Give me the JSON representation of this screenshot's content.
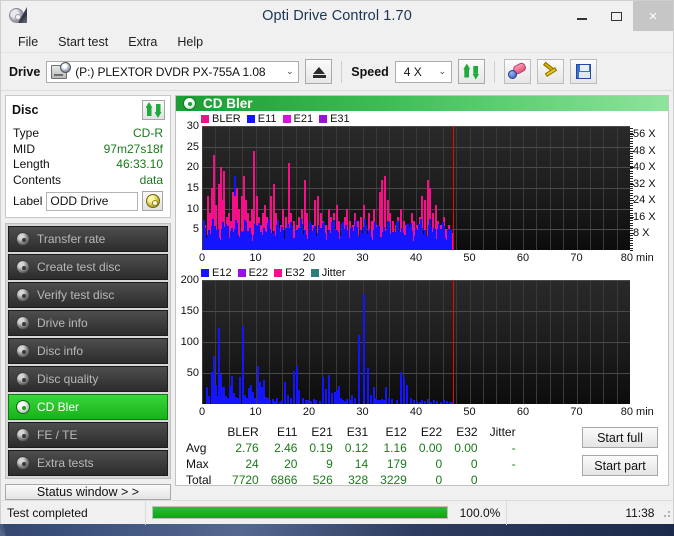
{
  "window": {
    "title": "Opti Drive Control 1.70",
    "icon": "optical-disc-icon",
    "minimize": "–",
    "maximize": "□",
    "close": "×"
  },
  "menu": {
    "items": [
      "File",
      "Start test",
      "Extra",
      "Help"
    ]
  },
  "toolbar": {
    "drive_label": "Drive",
    "drive_value": "(P:)  PLEXTOR DVDR   PX-755A 1.08",
    "eject_icon": "eject-icon",
    "speed_label": "Speed",
    "speed_value": "4 X",
    "refresh_icon": "refresh-icon",
    "erase_icon": "erase-icon",
    "tools_icon": "tools-icon",
    "save_icon": "save-icon",
    "dropdown_arrow": "⌄"
  },
  "disc": {
    "header": "Disc",
    "refresh_icon": "refresh-icon",
    "rows": [
      {
        "key": "Type",
        "value": "CD-R"
      },
      {
        "key": "MID",
        "value": "97m27s18f"
      },
      {
        "key": "Length",
        "value": "46:33.10"
      },
      {
        "key": "Contents",
        "value": "data"
      }
    ],
    "label_key": "Label",
    "label_value": "ODD Drive",
    "label_placeholder": "Label",
    "cd_icon": "cd-icon"
  },
  "nav": {
    "items": [
      {
        "label": "Transfer rate",
        "active": false
      },
      {
        "label": "Create test disc",
        "active": false
      },
      {
        "label": "Verify test disc",
        "active": false
      },
      {
        "label": "Drive info",
        "active": false
      },
      {
        "label": "Disc info",
        "active": false
      },
      {
        "label": "Disc quality",
        "active": false
      },
      {
        "label": "CD Bler",
        "active": true
      },
      {
        "label": "FE / TE",
        "active": false
      },
      {
        "label": "Extra tests",
        "active": false
      }
    ],
    "status_window_button": "Status window > >"
  },
  "panel": {
    "title": "CD Bler",
    "icon": "disc-icon"
  },
  "stats": {
    "columns": [
      "BLER",
      "E11",
      "E21",
      "E31",
      "E12",
      "E22",
      "E32",
      "Jitter"
    ],
    "rows": [
      {
        "label": "Avg",
        "values": [
          "2.76",
          "2.46",
          "0.19",
          "0.12",
          "1.16",
          "0.00",
          "0.00",
          "-"
        ]
      },
      {
        "label": "Max",
        "values": [
          "24",
          "20",
          "9",
          "14",
          "179",
          "0",
          "0",
          "-"
        ]
      },
      {
        "label": "Total",
        "values": [
          "7720",
          "6866",
          "526",
          "328",
          "3229",
          "0",
          "0",
          ""
        ]
      }
    ]
  },
  "actions": {
    "start_full": "Start full",
    "start_part": "Start part"
  },
  "statusbar": {
    "message": "Test completed",
    "percent": "100.0%",
    "progress_value": 100,
    "time": "11:38"
  },
  "chart_data": [
    {
      "type": "bar",
      "name": "bler-chart",
      "title": "CD Bler",
      "xlabel": "min",
      "ylabel": "",
      "xlim": [
        0,
        80
      ],
      "ylim": [
        0,
        30
      ],
      "y2lim": [
        0,
        60
      ],
      "xticks": [
        0,
        10,
        20,
        30,
        40,
        50,
        60,
        70,
        80
      ],
      "xtick_labels": [
        "0",
        "10",
        "20",
        "30",
        "40",
        "50",
        "60",
        "70",
        "80 min"
      ],
      "yticks": [
        5,
        10,
        15,
        20,
        25,
        30
      ],
      "y2ticks": [
        8,
        16,
        24,
        32,
        40,
        48,
        56
      ],
      "y2tick_labels": [
        "8 X",
        "16 X",
        "24 X",
        "32 X",
        "40 X",
        "48 X",
        "56 X"
      ],
      "grid": true,
      "legend": [
        {
          "name": "BLER",
          "color": "#f5108a"
        },
        {
          "name": "E11",
          "color": "#1414ff"
        },
        {
          "name": "E21",
          "color": "#dd11dd"
        },
        {
          "name": "E31",
          "color": "#9911dd"
        }
      ],
      "marker_line": {
        "x": 46.9,
        "color": "#ff0000"
      },
      "data_end_x": 46.6,
      "series": [
        {
          "name": "BLER",
          "color": "#f5108a",
          "x": [
            0.4,
            0.9,
            1.3,
            1.7,
            2.1,
            2.5,
            2.9,
            3.3,
            3.6,
            4.0,
            4.4,
            4.8,
            5.2,
            5.6,
            6.0,
            6.4,
            6.8,
            7.2,
            7.6,
            8.0,
            8.4,
            8.8,
            9.2,
            9.6,
            10.0,
            10.4,
            10.8,
            11.2,
            11.6,
            12.0,
            12.4,
            12.8,
            13.2,
            13.6,
            14.0,
            14.5,
            15.0,
            15.5,
            16.0,
            16.5,
            17.0,
            17.5,
            18.0,
            18.5,
            19.0,
            19.5,
            20.0,
            20.5,
            21.0,
            21.5,
            22.0,
            22.5,
            23.0,
            23.5,
            24.0,
            24.5,
            25.0,
            25.5,
            26.0,
            26.5,
            27.0,
            27.5,
            28.0,
            28.5,
            29.0,
            29.5,
            30.0,
            30.5,
            31.0,
            31.5,
            32.0,
            32.5,
            33.0,
            33.5,
            34.0,
            34.5,
            35.0,
            35.5,
            36.0,
            36.5,
            37.0,
            37.5,
            38.0,
            38.5,
            39.0,
            39.5,
            40.0,
            40.5,
            41.0,
            41.5,
            42.0,
            42.5,
            43.0,
            43.5,
            44.0,
            44.5,
            45.0,
            45.5,
            46.0,
            46.5
          ],
          "values": [
            6,
            13,
            9,
            15,
            23,
            11,
            16,
            20,
            12,
            19,
            8,
            9,
            7,
            14,
            13,
            15,
            10,
            13,
            18,
            12,
            9,
            7,
            10,
            24,
            13,
            8,
            6,
            9,
            11,
            8,
            7,
            13,
            16,
            9,
            7,
            6,
            10,
            8,
            21,
            9,
            7,
            6,
            8,
            10,
            17,
            9,
            7,
            6,
            12,
            13,
            9,
            7,
            6,
            10,
            8,
            9,
            11,
            7,
            6,
            8,
            10,
            7,
            6,
            9,
            7,
            8,
            11,
            6,
            9,
            7,
            10,
            6,
            14,
            17,
            18,
            12,
            9,
            7,
            6,
            8,
            10,
            7,
            6,
            5,
            9,
            7,
            6,
            8,
            13,
            12,
            17,
            15,
            9,
            11,
            7,
            6,
            8,
            5,
            6,
            4
          ]
        },
        {
          "name": "E11",
          "color": "#1414ff",
          "x": [
            0.4,
            0.9,
            1.3,
            1.7,
            2.1,
            2.5,
            2.9,
            3.3,
            3.6,
            4.0,
            4.4,
            4.8,
            5.2,
            5.6,
            6.0,
            6.4,
            6.8,
            7.2,
            7.6,
            8.0,
            8.4,
            8.8,
            9.2,
            9.6,
            10.0,
            10.4,
            10.8,
            11.2,
            11.6,
            12.0,
            12.4,
            12.8,
            13.2,
            13.6,
            14.0,
            14.5,
            15.0,
            15.5,
            16.0,
            16.5,
            17.0,
            17.5,
            18.0,
            18.5,
            19.0,
            19.5,
            20.0,
            20.5,
            21.0,
            21.5,
            22.0,
            22.5,
            23.0,
            23.5,
            24.0,
            24.5,
            25.0,
            25.5,
            26.0,
            26.5,
            27.0,
            27.5,
            28.0,
            28.5,
            29.0,
            29.5,
            30.0,
            30.5,
            31.0,
            31.5,
            32.0,
            32.5,
            33.0,
            33.5,
            34.0,
            34.5,
            35.0,
            35.5,
            36.0,
            36.5,
            37.0,
            37.5,
            38.0,
            38.5,
            39.0,
            39.5,
            40.0,
            40.5,
            41.0,
            41.5,
            42.0,
            42.5,
            43.0,
            43.5,
            44.0,
            44.5,
            45.0,
            45.5,
            46.0,
            46.5
          ],
          "values": [
            5,
            11,
            7,
            10,
            13,
            9,
            12,
            17,
            10,
            16,
            6,
            7,
            5,
            11,
            18,
            12,
            8,
            10,
            14,
            9,
            7,
            5,
            8,
            20,
            10,
            6,
            5,
            7,
            9,
            6,
            5,
            10,
            13,
            7,
            5,
            4,
            8,
            6,
            16,
            7,
            5,
            4,
            6,
            8,
            13,
            7,
            5,
            4,
            9,
            10,
            7,
            5,
            4,
            8,
            6,
            7,
            9,
            5,
            4,
            6,
            8,
            5,
            4,
            7,
            5,
            6,
            9,
            4,
            7,
            5,
            8,
            4,
            11,
            13,
            15,
            9,
            7,
            5,
            4,
            6,
            8,
            5,
            4,
            4,
            7,
            5,
            4,
            6,
            10,
            9,
            13,
            12,
            7,
            9,
            5,
            4,
            6,
            4,
            5,
            3
          ]
        }
      ]
    },
    {
      "type": "bar",
      "name": "e12-chart",
      "xlabel": "min",
      "ylabel": "",
      "xlim": [
        0,
        80
      ],
      "ylim": [
        0,
        200
      ],
      "xticks": [
        0,
        10,
        20,
        30,
        40,
        50,
        60,
        70,
        80
      ],
      "xtick_labels": [
        "0",
        "10",
        "20",
        "30",
        "40",
        "50",
        "60",
        "70",
        "80 min"
      ],
      "yticks": [
        50,
        100,
        150,
        200
      ],
      "grid": true,
      "legend": [
        {
          "name": "E12",
          "color": "#1414ff"
        },
        {
          "name": "E22",
          "color": "#9911dd"
        },
        {
          "name": "E32",
          "color": "#f5108a"
        },
        {
          "name": "Jitter",
          "color": "#2b7d7d"
        }
      ],
      "marker_line": {
        "x": 46.9,
        "color": "#ff0000"
      },
      "data_end_x": 46.6,
      "series": [
        {
          "name": "E12",
          "color": "#1414ff",
          "x": [
            0.7,
            1.2,
            1.6,
            2.0,
            2.4,
            2.7,
            3.0,
            3.4,
            3.7,
            4.0,
            4.3,
            4.6,
            5.0,
            5.4,
            5.8,
            6.2,
            6.6,
            7.0,
            7.4,
            7.8,
            8.2,
            8.6,
            9.0,
            9.4,
            9.8,
            10.2,
            10.6,
            11.0,
            11.4,
            11.8,
            12.2,
            12.6,
            13.0,
            13.4,
            13.8,
            14.3,
            14.8,
            15.3,
            15.9,
            16.4,
            17.0,
            17.5,
            18.0,
            18.6,
            19.2,
            19.7,
            20.2,
            20.7,
            21.2,
            21.8,
            22.4,
            23.0,
            23.6,
            24.2,
            24.6,
            25.0,
            25.4,
            25.8,
            26.2,
            26.6,
            27.0,
            27.4,
            27.9,
            28.5,
            29.2,
            30.0,
            30.8,
            31.4,
            31.9,
            32.3,
            32.7,
            33.0,
            33.2,
            33.5,
            33.8,
            34.2,
            34.7,
            35.4,
            36.2,
            37.0,
            37.6,
            38.2,
            38.8,
            39.4,
            40.0,
            40.5,
            41.0,
            41.5,
            42.0,
            42.6,
            43.2,
            43.8,
            44.4,
            45.0,
            45.6,
            46.2,
            46.5
          ],
          "values": [
            27,
            13,
            51,
            77,
            30,
            13,
            122,
            49,
            28,
            27,
            13,
            10,
            29,
            45,
            18,
            12,
            9,
            44,
            126,
            14,
            10,
            26,
            31,
            20,
            10,
            61,
            35,
            27,
            38,
            12,
            9,
            6,
            8,
            5,
            10,
            4,
            6,
            36,
            14,
            9,
            53,
            61,
            23,
            9,
            7,
            6,
            5,
            8,
            6,
            5,
            44,
            25,
            47,
            18,
            20,
            22,
            29,
            9,
            7,
            5,
            8,
            6,
            14,
            10,
            112,
            178,
            58,
            14,
            28,
            10,
            7,
            6,
            5,
            8,
            6,
            28,
            10,
            8,
            6,
            51,
            44,
            30,
            9,
            6,
            5,
            4,
            6,
            5,
            8,
            4,
            6,
            5,
            4,
            6,
            5,
            4,
            3
          ]
        }
      ]
    }
  ]
}
